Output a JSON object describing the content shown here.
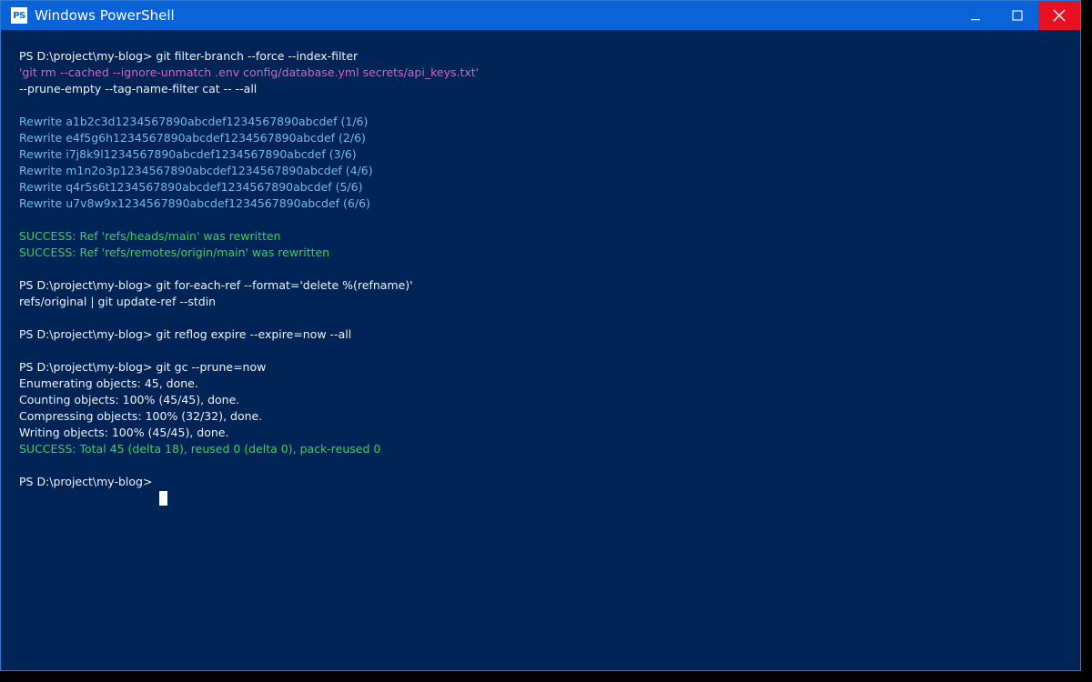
{
  "window": {
    "title": "Windows PowerShell",
    "icon_text": "PS"
  },
  "colors": {
    "background": "#012456",
    "titlebar": "#0a64d8",
    "close": "#e81123",
    "default_text": "#f2f2f2",
    "string_text": "#e05fc0",
    "rewrite_text": "#79b8e6",
    "success_text": "#3ad158"
  },
  "terminal": {
    "lines": [
      {
        "text": "PS D:\\project\\my-blog> git filter-branch --force --index-filter",
        "style": "default"
      },
      {
        "text": "'git rm --cached --ignore-unmatch .env config/database.yml secrets/api_keys.txt'",
        "style": "pink"
      },
      {
        "text": "--prune-empty --tag-name-filter cat -- --all",
        "style": "default"
      },
      {
        "text": "",
        "style": "default"
      },
      {
        "text": "Rewrite a1b2c3d1234567890abcdef1234567890abcdef (1/6)",
        "style": "blue"
      },
      {
        "text": "Rewrite e4f5g6h1234567890abcdef1234567890abcdef (2/6)",
        "style": "blue"
      },
      {
        "text": "Rewrite i7j8k9l1234567890abcdef1234567890abcdef (3/6)",
        "style": "blue"
      },
      {
        "text": "Rewrite m1n2o3p1234567890abcdef1234567890abcdef (4/6)",
        "style": "blue"
      },
      {
        "text": "Rewrite q4r5s6t1234567890abcdef1234567890abcdef (5/6)",
        "style": "blue"
      },
      {
        "text": "Rewrite u7v8w9x1234567890abcdef1234567890abcdef (6/6)",
        "style": "blue"
      },
      {
        "text": "",
        "style": "default"
      },
      {
        "text": "SUCCESS: Ref 'refs/heads/main' was rewritten",
        "style": "green"
      },
      {
        "text": "SUCCESS: Ref 'refs/remotes/origin/main' was rewritten",
        "style": "green"
      },
      {
        "text": "",
        "style": "default"
      },
      {
        "text": "PS D:\\project\\my-blog> git for-each-ref --format='delete %(refname)'",
        "style": "default"
      },
      {
        "text": "refs/original | git update-ref --stdin",
        "style": "default"
      },
      {
        "text": "",
        "style": "default"
      },
      {
        "text": "PS D:\\project\\my-blog> git reflog expire --expire=now --all",
        "style": "default"
      },
      {
        "text": "",
        "style": "default"
      },
      {
        "text": "PS D:\\project\\my-blog> git gc --prune=now",
        "style": "default"
      },
      {
        "text": "Enumerating objects: 45, done.",
        "style": "default"
      },
      {
        "text": "Counting objects: 100% (45/45), done.",
        "style": "default"
      },
      {
        "text": "Compressing objects: 100% (32/32), done.",
        "style": "default"
      },
      {
        "text": "Writing objects: 100% (45/45), done.",
        "style": "default"
      },
      {
        "text": "SUCCESS: Total 45 (delta 18), reused 0 (delta 0), pack-reused 0",
        "style": "green"
      },
      {
        "text": "",
        "style": "default"
      },
      {
        "text": "PS D:\\project\\my-blog>",
        "style": "default"
      }
    ]
  }
}
